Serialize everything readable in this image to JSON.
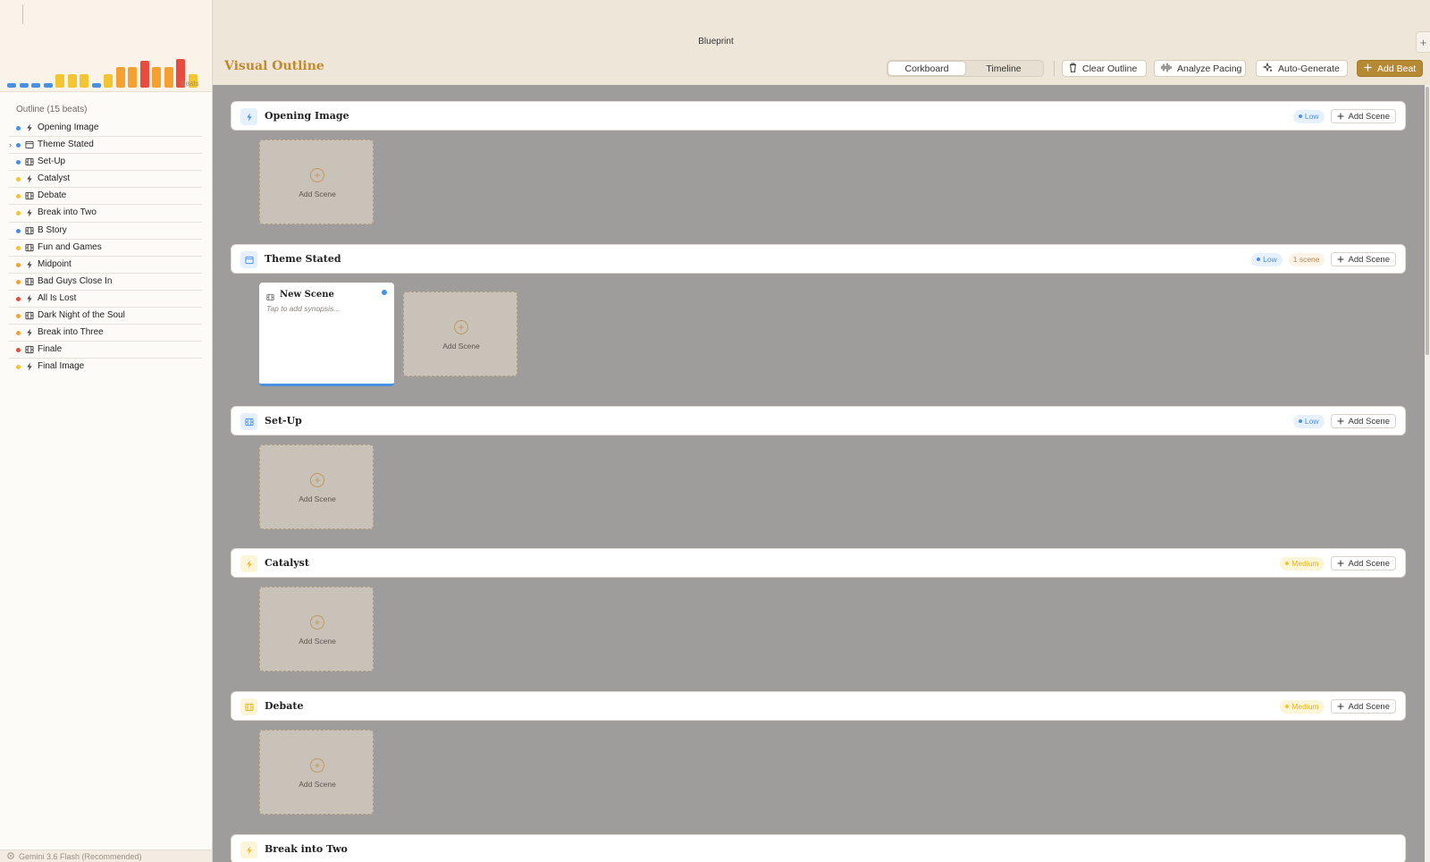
{
  "window": {
    "title": "Blueprint",
    "corner_button": "+"
  },
  "sidebar": {
    "pacing_label": "beats",
    "pacing_values": [
      {
        "level": 0.12,
        "color": "#4a90e2"
      },
      {
        "level": 0.12,
        "color": "#4a90e2"
      },
      {
        "level": 0.12,
        "color": "#4a90e2"
      },
      {
        "level": 0.12,
        "color": "#4a90e2"
      },
      {
        "level": 0.4,
        "color": "#f2c531"
      },
      {
        "level": 0.4,
        "color": "#f2c531"
      },
      {
        "level": 0.4,
        "color": "#f2c531"
      },
      {
        "level": 0.12,
        "color": "#4a90e2"
      },
      {
        "level": 0.4,
        "color": "#f2c531"
      },
      {
        "level": 0.6,
        "color": "#f5a030"
      },
      {
        "level": 0.6,
        "color": "#f5a030"
      },
      {
        "level": 0.8,
        "color": "#e94b3c"
      },
      {
        "level": 0.6,
        "color": "#f5a030"
      },
      {
        "level": 0.6,
        "color": "#f5a030"
      },
      {
        "level": 0.85,
        "color": "#e94b3c"
      },
      {
        "level": 0.4,
        "color": "#f2c531"
      }
    ],
    "outline_title": "Outline (15 beats)",
    "items": [
      {
        "label": "Opening Image",
        "dot": "#4a90e2",
        "icon": "bolt-icon",
        "chevron": ""
      },
      {
        "label": "Theme Stated",
        "dot": "#4a90e2",
        "icon": "calendar-icon",
        "chevron": "›"
      },
      {
        "label": "Set-Up",
        "dot": "#4a90e2",
        "icon": "film-icon",
        "chevron": ""
      },
      {
        "label": "Catalyst",
        "dot": "#f2c531",
        "icon": "bolt-icon",
        "chevron": ""
      },
      {
        "label": "Debate",
        "dot": "#f2c531",
        "icon": "film-icon",
        "chevron": ""
      },
      {
        "label": "Break into Two",
        "dot": "#f2c531",
        "icon": "bolt-icon",
        "chevron": ""
      },
      {
        "label": "B Story",
        "dot": "#4a90e2",
        "icon": "film-icon",
        "chevron": ""
      },
      {
        "label": "Fun and Games",
        "dot": "#f2c531",
        "icon": "film-icon",
        "chevron": ""
      },
      {
        "label": "Midpoint",
        "dot": "#f5a030",
        "icon": "bolt-icon",
        "chevron": ""
      },
      {
        "label": "Bad Guys Close In",
        "dot": "#f5a030",
        "icon": "film-icon",
        "chevron": ""
      },
      {
        "label": "All Is Lost",
        "dot": "#e94b3c",
        "icon": "bolt-icon",
        "chevron": ""
      },
      {
        "label": "Dark Night of the Soul",
        "dot": "#f5a030",
        "icon": "film-icon",
        "chevron": ""
      },
      {
        "label": "Break into Three",
        "dot": "#f5a030",
        "icon": "bolt-icon",
        "chevron": ""
      },
      {
        "label": "Finale",
        "dot": "#e94b3c",
        "icon": "film-icon",
        "chevron": ""
      },
      {
        "label": "Final Image",
        "dot": "#f2c531",
        "icon": "bolt-icon",
        "chevron": ""
      }
    ],
    "model_label": "Gemini 3.6 Flash (Recommended)"
  },
  "toolbar": {
    "page_title": "Visual Outline",
    "views": [
      "Corkboard",
      "Timeline"
    ],
    "active_view": "Corkboard",
    "clear_label": "Clear Outline",
    "analyze_label": "Analyze Pacing",
    "autogen_label": "Auto-Generate",
    "add_beat_label": "Add Beat"
  },
  "colors": {
    "accent": "#b68a33",
    "title": "#c28a2e",
    "low": "#4a90e2",
    "medium": "#f2c531",
    "high": "#f5a030",
    "critical": "#e94b3c"
  },
  "beats": [
    {
      "title": "Opening Image",
      "icon": "bolt-icon",
      "tone": "blue",
      "intensity": "Low",
      "scene_count": "",
      "add_label": "Add Scene",
      "scenes": [],
      "tile_label": "Add Scene"
    },
    {
      "title": "Theme Stated",
      "icon": "calendar-icon",
      "tone": "blue",
      "intensity": "Low",
      "scene_count": "1 scene",
      "add_label": "Add Scene",
      "scenes": [
        {
          "title": "New Scene",
          "synopsis": "Tap to add synopsis..."
        }
      ],
      "tile_label": "Add Scene"
    },
    {
      "title": "Set-Up",
      "icon": "film-icon",
      "tone": "blue",
      "intensity": "Low",
      "scene_count": "",
      "add_label": "Add Scene",
      "scenes": [],
      "tile_label": "Add Scene"
    },
    {
      "title": "Catalyst",
      "icon": "bolt-icon",
      "tone": "yellow",
      "intensity": "Medium",
      "scene_count": "",
      "add_label": "Add Scene",
      "scenes": [],
      "tile_label": "Add Scene"
    },
    {
      "title": "Debate",
      "icon": "film-icon",
      "tone": "yellow",
      "intensity": "Medium",
      "scene_count": "",
      "add_label": "Add Scene",
      "scenes": [],
      "tile_label": "Add Scene"
    },
    {
      "title": "Break into Two",
      "icon": "bolt-icon",
      "tone": "yellow",
      "intensity": "",
      "scene_count": "",
      "add_label": "",
      "scenes": [],
      "tile_label": ""
    }
  ]
}
